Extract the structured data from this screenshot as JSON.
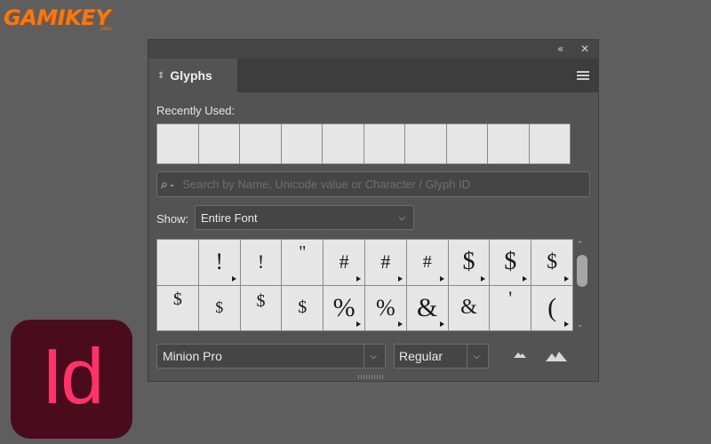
{
  "watermark": {
    "logo_text": "GAMIKEY",
    "logo_suffix": ".com"
  },
  "app_icon": {
    "label": "Id",
    "color": "#ff3369",
    "bg": "#4a0c1c"
  },
  "panel": {
    "titlebar": {
      "collapse_glyph": "«",
      "close_glyph": "✕"
    },
    "tab": {
      "arrows": "⇕",
      "label": "Glyphs"
    },
    "menu_icon": "hamburger-menu-icon",
    "recently_used": {
      "label": "Recently Used:",
      "cells": [
        "",
        "",
        "",
        "",
        "",
        "",
        "",
        "",
        "",
        ""
      ]
    },
    "search": {
      "placeholder": "Search by Name, Unicode value or Character / Glyph ID",
      "value": ""
    },
    "show": {
      "label": "Show:",
      "value": "Entire Font"
    },
    "glyphs": [
      {
        "char": "",
        "alt": false
      },
      {
        "char": "!",
        "alt": true
      },
      {
        "char": "!",
        "alt": false
      },
      {
        "char": "\"",
        "alt": false
      },
      {
        "char": "#",
        "alt": true
      },
      {
        "char": "#",
        "alt": true
      },
      {
        "char": "#",
        "alt": true
      },
      {
        "char": "$",
        "alt": true
      },
      {
        "char": "$",
        "alt": true
      },
      {
        "char": "$",
        "alt": true
      },
      {
        "char": "$",
        "alt": false
      },
      {
        "char": "$",
        "alt": false
      },
      {
        "char": "$",
        "alt": false
      },
      {
        "char": "$",
        "alt": false
      },
      {
        "char": "%",
        "alt": true
      },
      {
        "char": "%",
        "alt": true
      },
      {
        "char": "&",
        "alt": true
      },
      {
        "char": "&",
        "alt": false
      },
      {
        "char": "'",
        "alt": false
      },
      {
        "char": "(",
        "alt": true
      }
    ],
    "font": {
      "family": "Minion Pro",
      "style": "Regular"
    }
  }
}
